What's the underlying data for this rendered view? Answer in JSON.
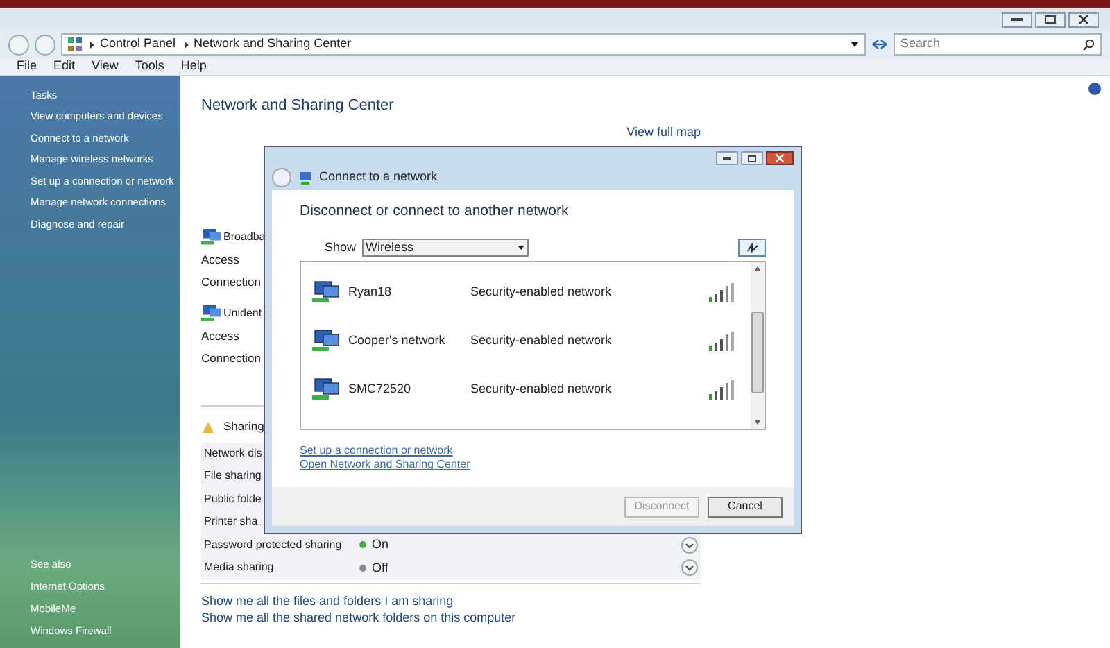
{
  "address_bar": {
    "crumbs": [
      "Control Panel",
      "Network and Sharing Center"
    ],
    "search_placeholder": "Search"
  },
  "menu": [
    "File",
    "Edit",
    "View",
    "Tools",
    "Help"
  ],
  "sidebar": {
    "tasks_title": "Tasks",
    "tasks": [
      "View computers and devices",
      "Connect to a network",
      "Manage wireless networks",
      "Set up a connection or network",
      "Manage network connections",
      "Diagnose and repair"
    ],
    "see_also_title": "See also",
    "see_also": [
      "Internet Options",
      "MobileMe",
      "Windows Firewall"
    ]
  },
  "content": {
    "title": "Network and Sharing Center",
    "map_link": "View full map",
    "networks": [
      {
        "name": "Broadba",
        "rows": [
          {
            "label": "Access"
          },
          {
            "label": "Connection"
          }
        ]
      },
      {
        "name": "Unident",
        "rows": [
          {
            "label": "Access"
          },
          {
            "label": "Connection"
          }
        ]
      }
    ],
    "sharing_title": "Sharing",
    "sharing": [
      {
        "label": "Network dis"
      },
      {
        "label": "File sharing"
      },
      {
        "label": "Public folde"
      },
      {
        "label": "Printer sha"
      },
      {
        "label": "Password protected sharing",
        "value": "On",
        "on": true
      },
      {
        "label": "Media sharing",
        "value": "Off",
        "on": false
      }
    ],
    "links": [
      "Show me all the files and folders I am sharing",
      "Show me all the shared network folders on this computer"
    ]
  },
  "dialog": {
    "title": "Connect to a network",
    "heading": "Disconnect or connect to another network",
    "show_label": "Show",
    "show_value": "Wireless",
    "networks": [
      {
        "name": "Ryan18",
        "security": "Security-enabled network"
      },
      {
        "name": "Cooper's network",
        "security": "Security-enabled network"
      },
      {
        "name": "SMC72520",
        "security": "Security-enabled network"
      }
    ],
    "links": [
      "Set up a connection or network",
      "Open Network and Sharing Center"
    ],
    "buttons": [
      {
        "label": "Disconnect",
        "disabled": true
      },
      {
        "label": "Cancel",
        "disabled": false
      }
    ]
  }
}
